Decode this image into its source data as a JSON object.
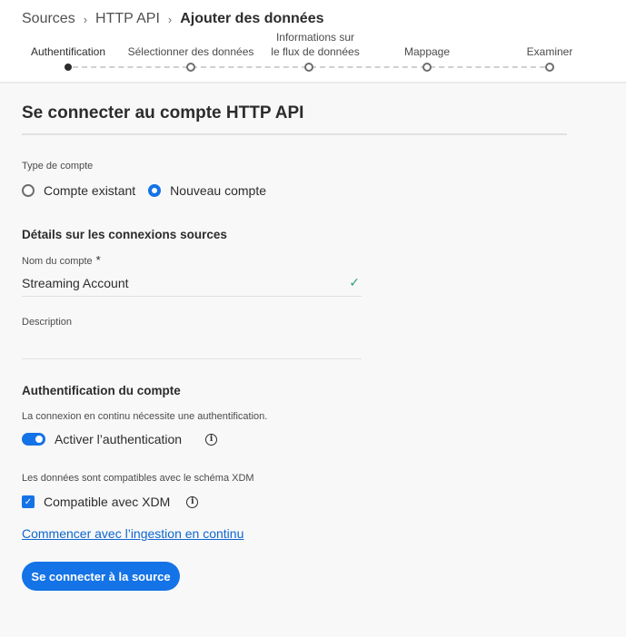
{
  "breadcrumb": {
    "items": [
      "Sources",
      "HTTP API"
    ],
    "separator": "›",
    "current": "Ajouter des données"
  },
  "steps": [
    {
      "label": "Authentification",
      "active": true
    },
    {
      "label": "Sélectionner des données",
      "active": false
    },
    {
      "label_line1": "Informations sur",
      "label_line2": "le flux de données",
      "active": false
    },
    {
      "label": "Mappage",
      "active": false
    },
    {
      "label": "Examiner",
      "active": false
    }
  ],
  "form": {
    "title": "Se connecter au compte HTTP API",
    "account_type": {
      "label": "Type de compte",
      "options": [
        "Compte existant",
        "Nouveau compte"
      ],
      "selected": "Nouveau compte"
    },
    "source_details": {
      "heading": "Détails sur les connexions sources",
      "account_name_label": "Nom du compte",
      "required_marker": "*",
      "account_name_value": "Streaming Account",
      "valid_marker": "✓",
      "description_label": "Description",
      "description_value": ""
    },
    "auth": {
      "heading": "Authentification du compte",
      "note": "La connexion en continu nécessite une authentification.",
      "toggle_label": "Activer l’authentication",
      "toggle_on": true
    },
    "xdm": {
      "note": "Les données sont compatibles avec le schéma XDM",
      "checkbox_label": "Compatible avec XDM",
      "checked": true
    },
    "link_text": "Commencer avec l’ingestion en continu",
    "submit_label": "Se connecter à la source"
  },
  "icons": {
    "info": "info-icon",
    "checkmark": "check-icon"
  },
  "colors": {
    "accent": "#1473e6",
    "link": "#0d66d0",
    "valid": "#2d9d78"
  }
}
